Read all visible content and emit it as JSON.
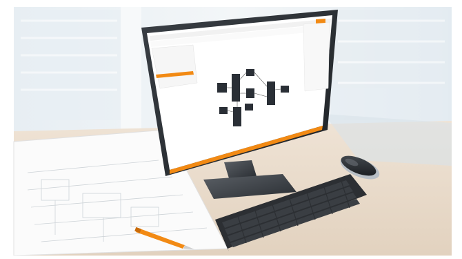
{
  "scene": {
    "description_kind": "photo",
    "colors": {
      "accent": "#f28a14",
      "desk": "#e9dccd",
      "wall": "#dfe8ee",
      "monitor_frame": "#2f3338",
      "keyboard": "#2c2f33",
      "mouse_body": "#1f2227"
    }
  }
}
